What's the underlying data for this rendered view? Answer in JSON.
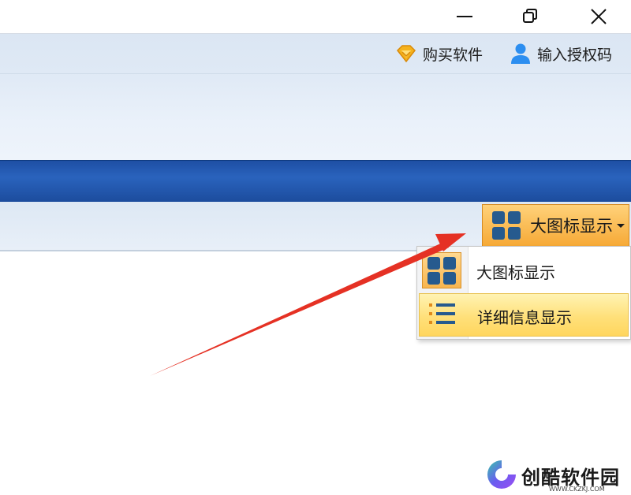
{
  "window": {
    "minimize": "minimize-window",
    "maximize": "restore-window",
    "close": "close-window"
  },
  "header_actions": {
    "buy_label": "购买软件",
    "buy_icon": "diamond-icon",
    "auth_label": "输入授权码",
    "auth_icon": "user-icon"
  },
  "toolbar": {
    "view_button_label": "大图标显示",
    "view_button_icon": "grid-icon"
  },
  "view_menu": {
    "items": [
      {
        "label": "大图标显示",
        "icon": "grid-icon",
        "state": "checked"
      },
      {
        "label": "详细信息显示",
        "icon": "list-icon",
        "state": "hovered"
      }
    ]
  },
  "colors": {
    "accent_orange": "#f6a936",
    "band_blue": "#2a63bd",
    "arrow_red": "#e53124",
    "highlight_yellow": "#ffe07a"
  },
  "watermark": {
    "name": "创酷软件园",
    "url": "WWW.CKZKJ.COM"
  }
}
